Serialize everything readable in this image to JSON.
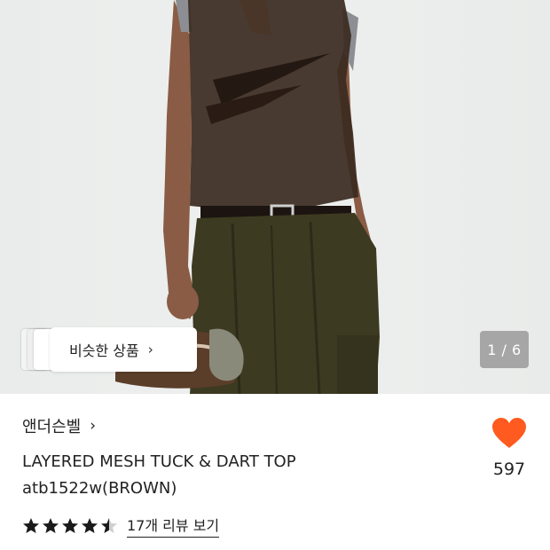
{
  "gallery": {
    "similar_label": "비슷한 상품",
    "similar_chevron": "›",
    "pager_text": "1 / 6",
    "current_index": 1,
    "total": 6
  },
  "product": {
    "brand_label": "앤더슨벨",
    "brand_chevron": "›",
    "title_line1": "LAYERED MESH TUCK & DART TOP",
    "title_line2": "atb1522w(BROWN)"
  },
  "like": {
    "icon": "heart-icon",
    "color": "#ff5a1f",
    "count": "597"
  },
  "rating": {
    "value": 4.5,
    "max": 5,
    "star_color": "#1a1a1a",
    "review_link": "17개 리뷰 보기"
  }
}
